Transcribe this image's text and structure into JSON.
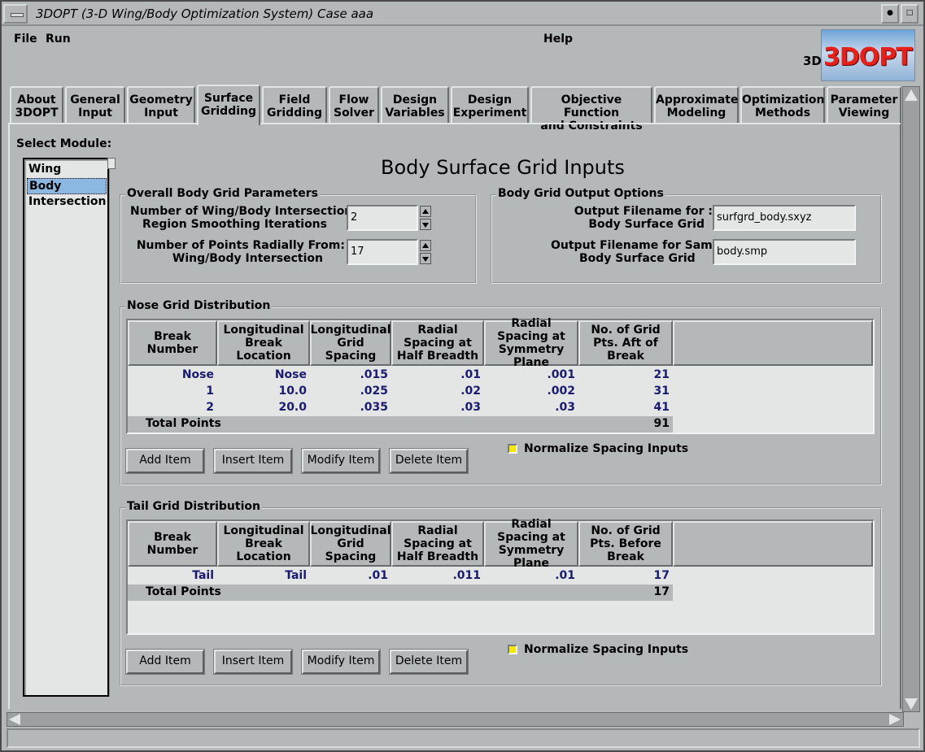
{
  "window": {
    "title": "3DOPT (3-D Wing/Body Optimization System) Case aaa"
  },
  "menubar": {
    "file": "File",
    "run": "Run",
    "help": "Help"
  },
  "logo": {
    "prefix": "3D",
    "text": "3DOPT"
  },
  "tabs": [
    {
      "line1": "About",
      "line2": "3DOPT"
    },
    {
      "line1": "General",
      "line2": "Input"
    },
    {
      "line1": "Geometry",
      "line2": "Input"
    },
    {
      "line1": "Surface",
      "line2": "Gridding"
    },
    {
      "line1": "Field",
      "line2": "Gridding"
    },
    {
      "line1": "Flow",
      "line2": "Solver"
    },
    {
      "line1": "Design",
      "line2": "Variables"
    },
    {
      "line1": "Design",
      "line2": "Experiment"
    },
    {
      "line1": "Objective Function",
      "line2": "and Constraints"
    },
    {
      "line1": "Approximate",
      "line2": "Modeling"
    },
    {
      "line1": "Optimization",
      "line2": "Methods"
    },
    {
      "line1": "Parameter",
      "line2": "Viewing"
    }
  ],
  "active_tab": "Surface Gridding",
  "modules": {
    "label": "Select Module:",
    "items": [
      "Wing",
      "Body",
      "Intersection"
    ],
    "selected": "Body"
  },
  "main": {
    "heading": "Body Surface Grid Inputs"
  },
  "overall": {
    "title": "Overall Body Grid Parameters",
    "smoothing_label_1": "Number of Wing/Body Intersection:",
    "smoothing_label_2": "Region Smoothing Iterations",
    "smoothing_value": "2",
    "radial_label_1": "Number of Points Radially From:",
    "radial_label_2": "Wing/Body Intersection",
    "radial_value": "17"
  },
  "output": {
    "title": "Body Grid Output Options",
    "file_label_1": "Output Filename for :",
    "file_label_2": "Body Surface Grid",
    "file_value": "surfgrd_body.sxyz",
    "sample_label_1": "Output Filename for Sample:",
    "sample_label_2": "Body Surface Grid",
    "sample_value": "body.smp"
  },
  "nose": {
    "title": "Nose Grid Distribution",
    "headers": [
      "Break Number",
      "Longitudinal Break Location",
      "Longitudinal Grid Spacing",
      "Radial Spacing at Half Breadth",
      "Radial Spacing at Symmetry Plane",
      "No. of Grid Pts. Aft of Break"
    ],
    "rows": [
      [
        "Nose",
        "Nose",
        ".015",
        ".01",
        ".001",
        "21"
      ],
      [
        "1",
        "10.0",
        ".025",
        ".02",
        ".002",
        "31"
      ],
      [
        "2",
        "20.0",
        ".035",
        ".03",
        ".03",
        "41"
      ]
    ],
    "total_label": "Total Points",
    "total_value": "91",
    "normalize": "Normalize Spacing Inputs"
  },
  "tail": {
    "title": "Tail Grid Distribution",
    "headers": [
      "Break Number",
      "Longitudinal Break Location",
      "Longitudinal Grid Spacing",
      "Radial Spacing at Half Breadth",
      "Radial Spacing at Symmetry Plane",
      "No. of Grid Pts. Before Break"
    ],
    "rows": [
      [
        "Tail",
        "Tail",
        ".01",
        ".011",
        ".01",
        "17"
      ]
    ],
    "total_label": "Total Points",
    "total_value": "17",
    "normalize": "Normalize Spacing Inputs"
  },
  "buttons": {
    "add": "Add Item",
    "insert": "Insert Item",
    "modify": "Modify Item",
    "delete": "Delete Item"
  }
}
